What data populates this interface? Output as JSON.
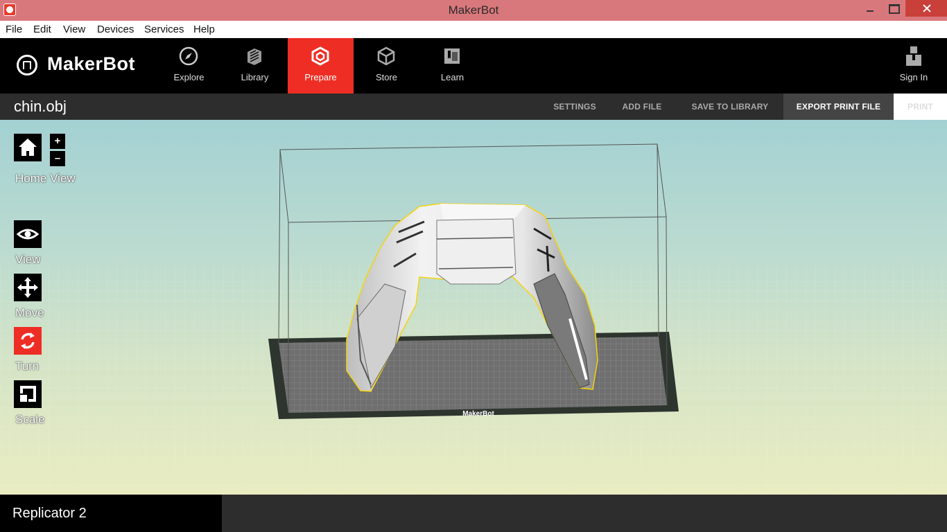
{
  "window": {
    "title": "MakerBot"
  },
  "menu": [
    "File",
    "Edit",
    "View",
    "Devices",
    "Services",
    "Help"
  ],
  "brand": {
    "name": "MakerBot"
  },
  "nav": {
    "tabs": [
      {
        "label": "Explore",
        "icon": "compass-icon"
      },
      {
        "label": "Library",
        "icon": "library-stack-icon"
      },
      {
        "label": "Prepare",
        "icon": "prepare-cube-icon",
        "active": true
      },
      {
        "label": "Store",
        "icon": "box-icon"
      },
      {
        "label": "Learn",
        "icon": "book-icon"
      }
    ],
    "sign_in": "Sign In"
  },
  "file_bar": {
    "file_name": "chin.obj",
    "actions": {
      "settings": "SETTINGS",
      "add_file": "ADD FILE",
      "save_to_library": "SAVE TO LIBRARY",
      "export": "EXPORT PRINT FILE",
      "print": "PRINT"
    }
  },
  "tools": {
    "home_view": "Home View",
    "zoom_in": "+",
    "zoom_out": "–",
    "view": "View",
    "move": "Move",
    "turn": "Turn",
    "scale": "Scale"
  },
  "build_plate": {
    "brand_mark": "MakerBot"
  },
  "printer": {
    "name": "Replicator 2"
  },
  "colors": {
    "accent": "#ee2e24",
    "selection_outline": "#f5d30c"
  }
}
